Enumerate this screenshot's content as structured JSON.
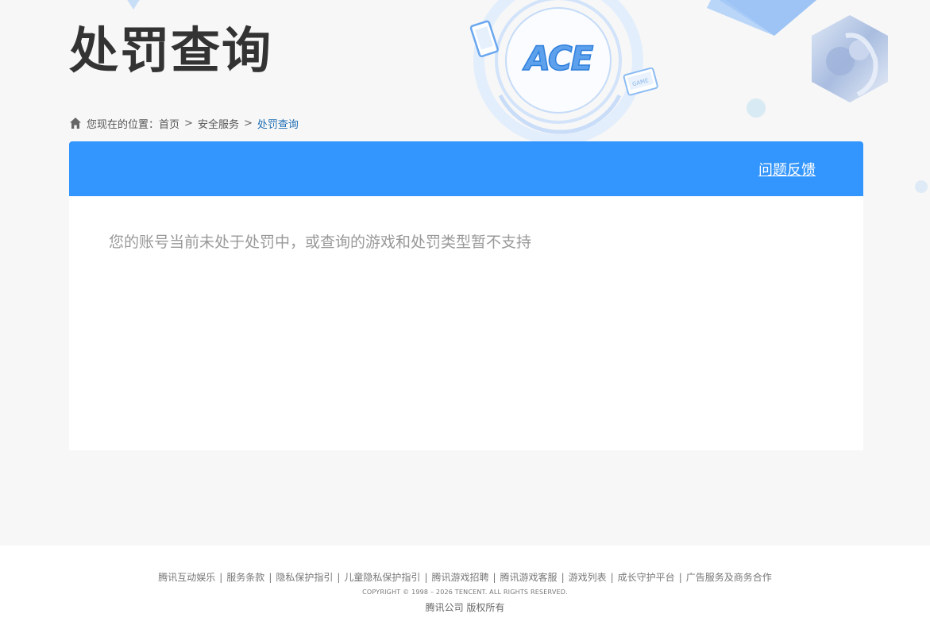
{
  "header": {
    "title": "处罚查询",
    "logo_text": "ACE",
    "device_label": "GAME"
  },
  "breadcrumb": {
    "prefix": "您现在的位置：",
    "items": [
      "首页",
      "安全服务"
    ],
    "separator": ">",
    "current": "处罚查询"
  },
  "panel": {
    "feedback_label": "问题反馈",
    "message": "您的账号当前未处于处罚中，或查询的游戏和处罚类型暂不支持"
  },
  "footer": {
    "links": [
      "腾讯互动娱乐",
      "服务条款",
      "隐私保护指引",
      "儿童隐私保护指引",
      "腾讯游戏招聘",
      "腾讯游戏客服",
      "游戏列表",
      "成长守护平台",
      "广告服务及商务合作"
    ],
    "separator": "|",
    "copyright": "COPYRIGHT © 1998 – 2026 TENCENT. ALL RIGHTS RESERVED.",
    "company": "腾讯公司 版权所有"
  },
  "colors": {
    "accent": "#3396fe",
    "title": "#333333",
    "current_crumb": "#1f6fb5",
    "message": "#999999",
    "background": "#f7f7f7"
  },
  "icons": {
    "home": "home-icon",
    "logo": "ace-logo-icon",
    "avatar": "character-hexagon-icon"
  }
}
